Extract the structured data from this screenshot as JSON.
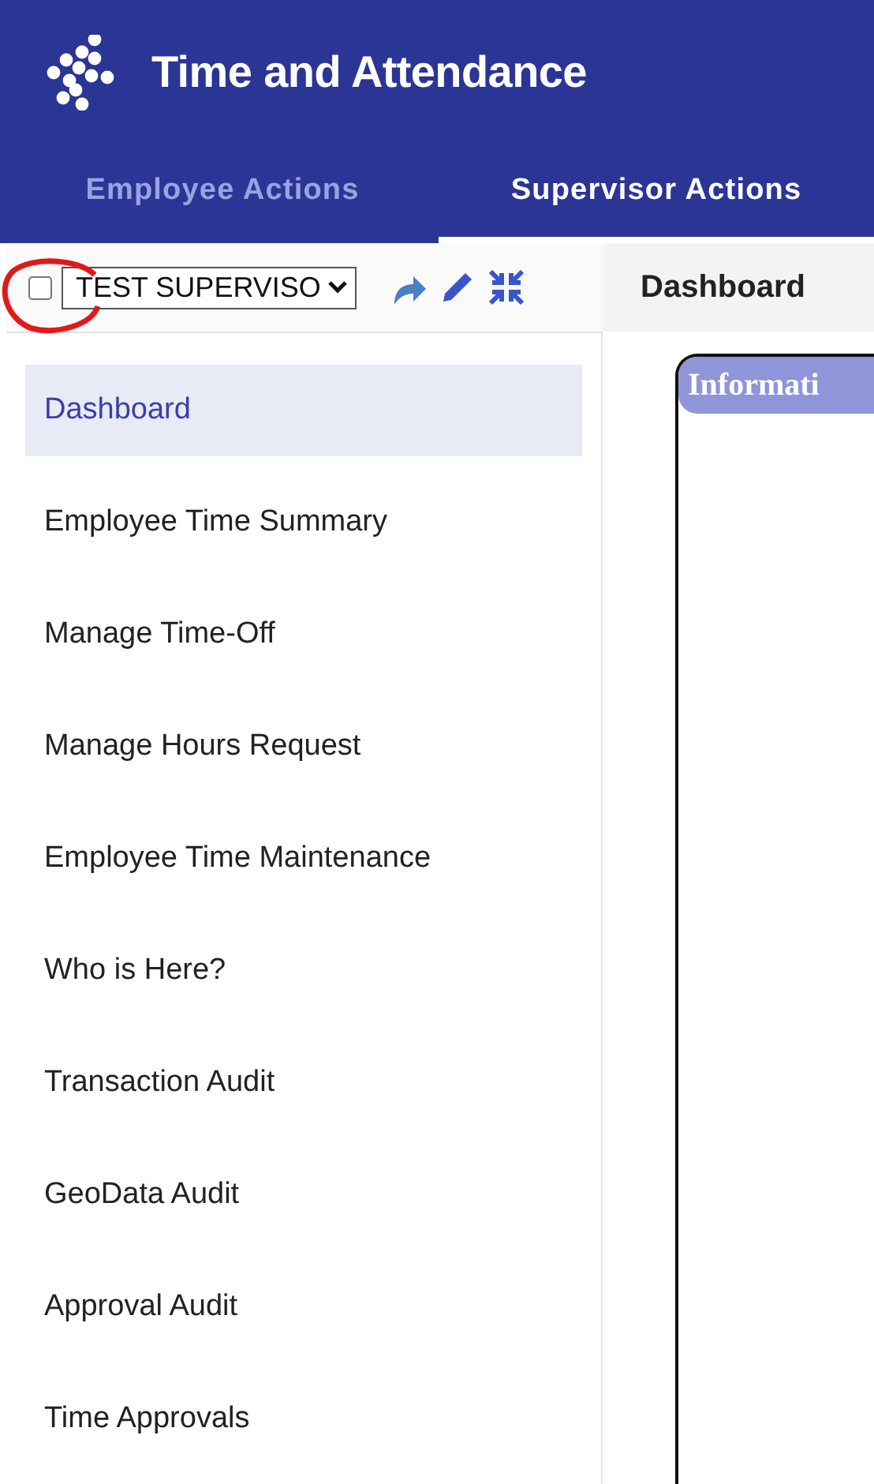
{
  "app": {
    "title": "Time and Attendance"
  },
  "tabs": [
    {
      "label": "Employee Actions",
      "selected": false
    },
    {
      "label": "Supervisor Actions",
      "selected": true
    }
  ],
  "toolbar": {
    "select_all_checked": false,
    "supervisor": "TEST SUPERVISO",
    "breadcrumb": "Dashboard"
  },
  "annotation": {
    "kind": "circle"
  },
  "sidebar": {
    "items": [
      {
        "label": "Dashboard",
        "selected": true
      },
      {
        "label": "Employee Time Summary",
        "selected": false
      },
      {
        "label": "Manage Time-Off",
        "selected": false
      },
      {
        "label": "Manage Hours Request",
        "selected": false
      },
      {
        "label": "Employee Time Maintenance",
        "selected": false
      },
      {
        "label": "Who is Here?",
        "selected": false
      },
      {
        "label": "Transaction Audit",
        "selected": false
      },
      {
        "label": "GeoData Audit",
        "selected": false
      },
      {
        "label": "Approval Audit",
        "selected": false
      },
      {
        "label": "Time Approvals",
        "selected": false
      }
    ]
  },
  "panel": {
    "title": "Informati"
  }
}
